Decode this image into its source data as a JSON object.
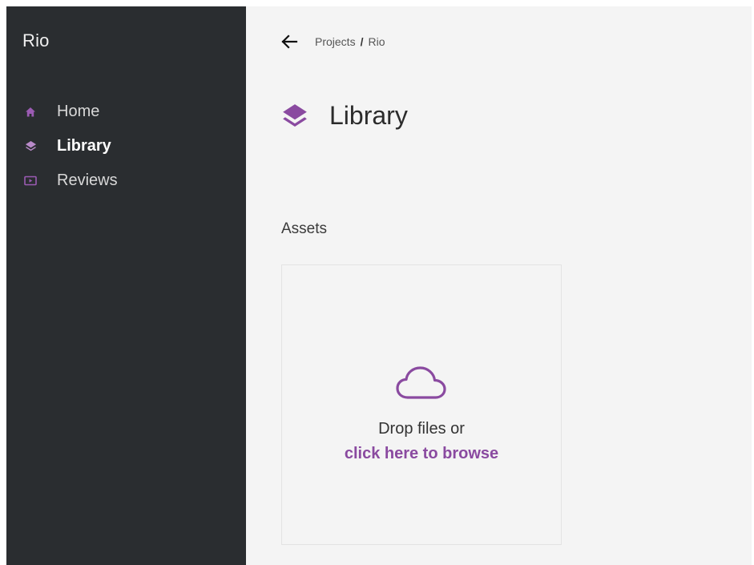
{
  "app": {
    "title": "Rio"
  },
  "sidebar": {
    "items": [
      {
        "label": "Home",
        "icon": "home-icon",
        "active": false
      },
      {
        "label": "Library",
        "icon": "layers-icon",
        "active": true
      },
      {
        "label": "Reviews",
        "icon": "play-screen-icon",
        "active": false
      }
    ]
  },
  "header": {
    "breadcrumb": {
      "parent": "Projects",
      "separator": "/",
      "current": "Rio"
    }
  },
  "page": {
    "title": "Library",
    "icon": "layers-icon"
  },
  "assets": {
    "section_label": "Assets",
    "dropzone": {
      "line1": "Drop files or",
      "line2": "click here to browse",
      "icon": "cloud-upload-icon"
    }
  },
  "colors": {
    "accent": "#8a4aa0",
    "sidebar_bg": "#2a2d30",
    "main_bg": "#f4f4f4"
  }
}
